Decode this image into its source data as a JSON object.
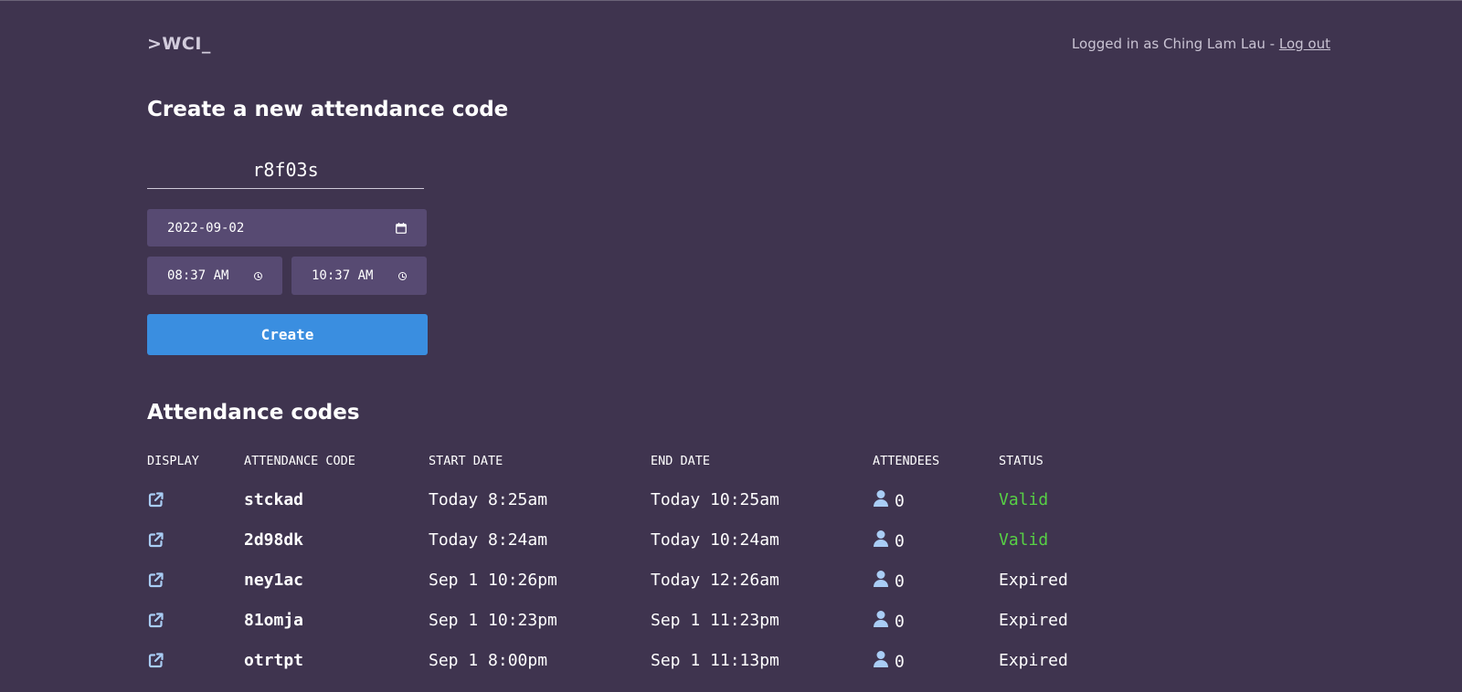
{
  "header": {
    "logo": ">WCI_",
    "logged_in_text": "Logged in as Ching Lam Lau - ",
    "logout_label": "Log out"
  },
  "create_form": {
    "title": "Create a new attendance code",
    "code_value": "r8f03s",
    "date_value": "2022-09-02",
    "start_time": "08:37 AM",
    "end_time": "10:37 AM",
    "create_label": "Create"
  },
  "codes_table": {
    "title": "Attendance codes",
    "columns": [
      "DISPLAY",
      "ATTENDANCE CODE",
      "START DATE",
      "END DATE",
      "ATTENDEES",
      "STATUS"
    ],
    "rows": [
      {
        "code": "stckad",
        "start": "Today 8:25am",
        "end": "Today 10:25am",
        "attendees": "0",
        "status": "Valid"
      },
      {
        "code": "2d98dk",
        "start": "Today 8:24am",
        "end": "Today 10:24am",
        "attendees": "0",
        "status": "Valid"
      },
      {
        "code": "ney1ac",
        "start": "Sep 1 10:26pm",
        "end": "Today 12:26am",
        "attendees": "0",
        "status": "Expired"
      },
      {
        "code": "81omja",
        "start": "Sep 1 10:23pm",
        "end": "Sep 1 11:23pm",
        "attendees": "0",
        "status": "Expired"
      },
      {
        "code": "otrtpt",
        "start": "Sep 1 8:00pm",
        "end": "Sep 1 11:13pm",
        "attendees": "0",
        "status": "Expired"
      }
    ]
  },
  "colors": {
    "background": "#3f344f",
    "field_bg": "#574a72",
    "button_bg": "#3a8ee0",
    "valid": "#57d045",
    "icon": "#a9cdf5"
  },
  "icons": {
    "display": "external-link-icon",
    "attendees": "user-icon",
    "date": "calendar-icon",
    "time": "clock-icon"
  }
}
